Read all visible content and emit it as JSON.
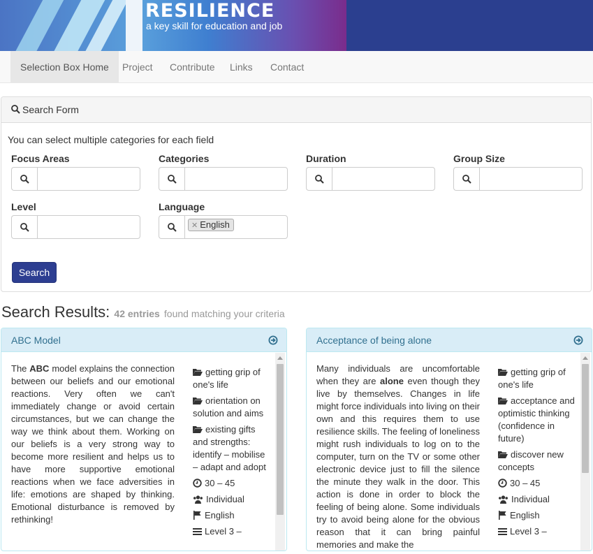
{
  "banner": {
    "title": "RESILIENCE",
    "subtitle": "a key skill for education and job"
  },
  "nav": [
    "Selection Box Home",
    "Project",
    "Contribute",
    "Links",
    "Contact"
  ],
  "search_form": {
    "title": "Search Form",
    "hint": "You can select multiple categories for each field",
    "fields": {
      "focus_areas": "Focus Areas",
      "categories": "Categories",
      "duration": "Duration",
      "group_size": "Group Size",
      "level": "Level",
      "language": "Language"
    },
    "language_tag": "English",
    "button": "Search"
  },
  "results": {
    "heading": "Search Results:",
    "count": "42 entries",
    "found_text": "found matching your criteria"
  },
  "cards": [
    {
      "title": "ABC Model",
      "desc_pre": "The ",
      "desc_bold": "ABC",
      "desc_post": " model explains the connection between our beliefs and our emotional reactions. Very often we can't immediately change or avoid certain circumstances, but we can change the way we think about them. Working on our beliefs is a very strong way to become more resilient and helps us to have more supportive emotional reactions when we face adversities in life: emotions are shaped by thinking. Emotional disturbance is removed by rethinking!",
      "focus": [
        "getting grip of one's life",
        "orientation on solution and aims",
        "existing gifts and strengths: identify – mobilise – adapt and adopt"
      ],
      "duration": "30 – 45",
      "group": "Individual",
      "language": "English",
      "level": "Level 3 –"
    },
    {
      "title": "Acceptance of being alone",
      "desc_pre": "Many individuals are uncomfortable when they are ",
      "desc_bold": "alone",
      "desc_post": " even though they live by themselves. Changes in life might force individuals into living on their own and this requires them to use resilience skills. The feeling of loneliness might rush individuals to log on to the computer, turn on the TV or some other electronic device just to fill the silence the minute they walk in the door. This action is done in order to block the feeling of being alone. Some individuals try to avoid being alone for the obvious reason that it can bring painful memories and make the",
      "focus": [
        "getting grip of one's life",
        "acceptance and optimistic thinking (confidence in future)",
        "discover new concepts"
      ],
      "duration": "30 – 45",
      "group": "Individual",
      "language": "English",
      "level": "Level 3 –"
    }
  ]
}
